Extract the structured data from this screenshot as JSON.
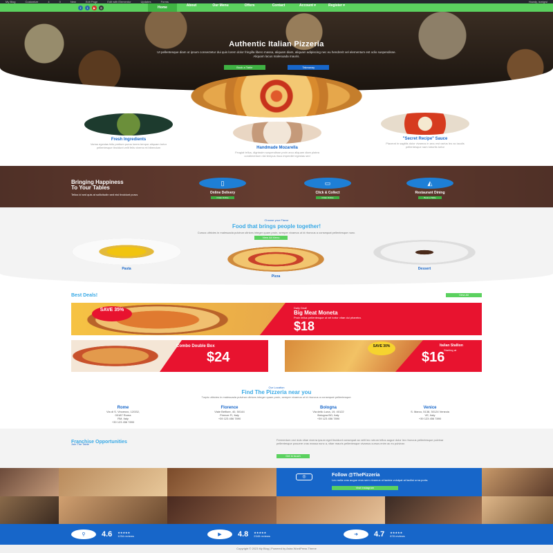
{
  "adminbar": {
    "items": [
      "My Blog",
      "Customize",
      "4",
      "0",
      "New",
      "Edit Page",
      "Edit with Elementor",
      "Updates",
      "Forms"
    ],
    "right": "Howdy, ismigwi"
  },
  "nav": {
    "items": [
      "Home",
      "About",
      "Our Menu",
      "Offers",
      "Contact",
      "Account",
      "Register"
    ],
    "active": 0
  },
  "hero": {
    "title": "Authentic Italian Pizzeria",
    "text": "Ut pellentesque diam ut ipsum consectetur dui quis lorem dolor fringilla libero massa, aliquam diam, aliquam adipiscing nec eu hendrerit vel elementum est odio suspendisse. Aliquam lacus malesuada mauris.",
    "btn_book": "Book a Table",
    "btn_takeaway": "Takeaway"
  },
  "features": [
    {
      "title": "Fresh Ingredients",
      "text": "Varius egestas felis pretium purus lorem tempor aliquam tortor pellentesque tincidunt velit felis viverra mi bibendum"
    },
    {
      "title": "Handmade Mozarella",
      "text": "Feugiat tellus, dignissim suspendisse proin arcu aliquam diam platea condimentum nisl tempus risus imperdiet egestas sed"
    },
    {
      "title": "\"Secret Recipe\" Sauce",
      "text": "Placerat in sagittis dolor vivamus in arcu est varius leo ac iaculis pellentesque nam lobortis tortor"
    }
  ],
  "band": {
    "title": "Bringing Happiness",
    "title2": "To Your Tables",
    "text": "Tellus id sed quis at sollicitudin sed nisl tincidunt purus",
    "services": [
      {
        "label": "Online Delivery",
        "btn": "Order Online"
      },
      {
        "label": "Click & Collect",
        "btn": "Order Online"
      },
      {
        "label": "Restaurant Dining",
        "btn": "Book a Table"
      }
    ]
  },
  "menu": {
    "eyebrow": "Choose your Flavor",
    "title": "Food that brings people together!",
    "text": "Cursus ultricies in malesuada pulvinar ultrices integer quam proin, semper vivamus ut id rhoncus a consequat pellentesque nunc.",
    "btn": "View All Menu",
    "items": [
      "Pasta",
      "Pizza",
      "Dessert"
    ]
  },
  "deals": {
    "title": "Best Deals!",
    "view_all": "View All",
    "main": {
      "badge": "SAVE 35%",
      "eyebrow": "Daily Deal!",
      "name": "Big Meat Moneta",
      "desc": "Proin tellus pellentesque ut vel tortor vitae dui pharetra.",
      "price": "$18"
    },
    "combo": {
      "name": "Combo Double Box",
      "price": "$24"
    },
    "stallion": {
      "badge": "SAVE 30%",
      "name": "Italian Stallion",
      "starting": "Starting at",
      "price": "$16"
    }
  },
  "locations": {
    "eyebrow": "Our Location",
    "title": "Find The Pizzeria near you",
    "text": "Turpis ultricies in malesuada pulvinar ultrices integer quam proin, semper vivamus ut id rhoncus a consequat pellentesque.",
    "cities": [
      {
        "name": "Rome",
        "addr": "Via di S. Vincenzo, 12/332,",
        "addr2": "00187 Roma",
        "country": "RM, Italy",
        "phone": "+39 123 456 7890"
      },
      {
        "name": "Florence",
        "addr": "Viale Belfiore, 40, 50144",
        "addr2": "Firenze FI, Italy",
        "country": "",
        "phone": "+39 123 456 7890"
      },
      {
        "name": "Bologna",
        "addr": "Via dello Luna, 19, 40122",
        "addr2": "Bologna BO, Italy",
        "country": "",
        "phone": "+39 123 456 7890"
      },
      {
        "name": "Venice",
        "addr": "S. Marco, 5138, 30124 Venezia",
        "addr2": "VE, Italy",
        "country": "",
        "phone": "+39 123 456 7890"
      }
    ]
  },
  "franchise": {
    "eyebrow": "Join The Table",
    "title": "Franchise Opportunities",
    "text": "Fermentum orci duis vitae viverra ipsum eget tincidunt consequat ac velit leo rutrum tellus augue dolor leo rhoncus pellentesque pulvinar pellentesque posuere cras massa nunc a, vitae mauris pellentesque vivamus cursus enim ac eu pulvinar.",
    "btn": "Get in touch"
  },
  "follow": {
    "title": "Follow @ThePizzeria",
    "text": "Leo nulla cras augue eros sem vivamus ut lacinia volutpat at facilisi urna porta.",
    "btn": "Visit Instagram"
  },
  "stats": [
    {
      "value": "4.6",
      "stars": "★★★★★",
      "reviews": "1234 reviews"
    },
    {
      "value": "4.8",
      "stars": "★★★★★",
      "reviews": "2345 reviews"
    },
    {
      "value": "4.7",
      "stars": "★★★★★",
      "reviews": "678 reviews"
    }
  ],
  "footer": "Copyright © 2023 My Blog | Powered by Astra WordPress Theme"
}
